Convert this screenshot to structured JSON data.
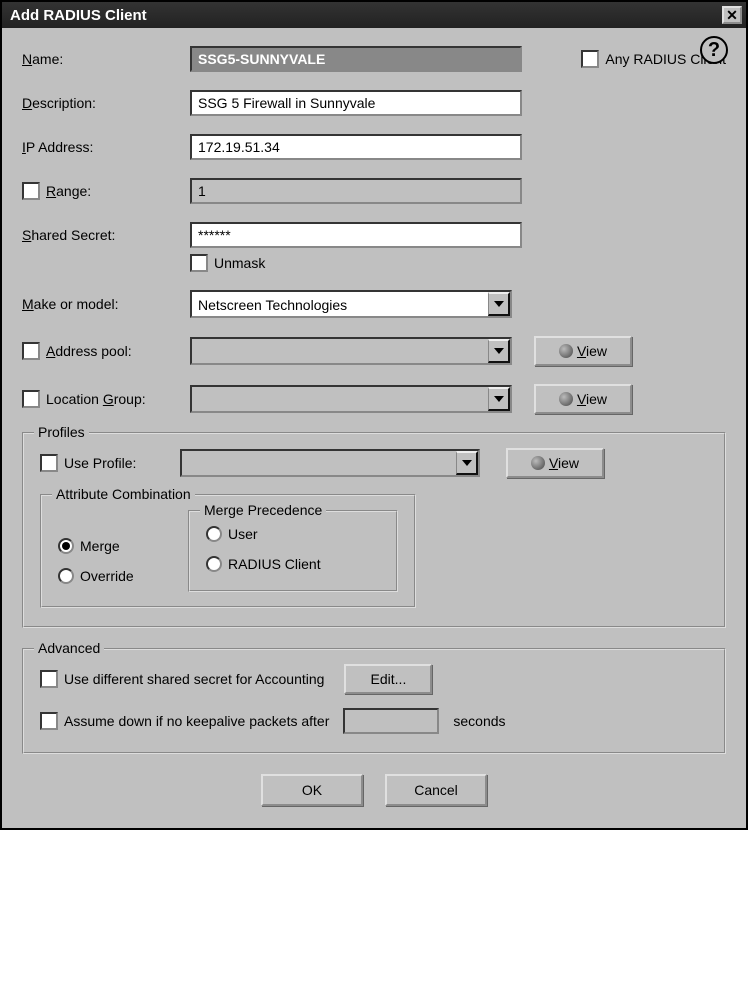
{
  "window": {
    "title": "Add RADIUS Client"
  },
  "labels": {
    "name": "Name:",
    "any_client": "Any RADIUS Client",
    "description": "Description:",
    "ip_address": "IP Address:",
    "range": "Range:",
    "shared_secret": "Shared Secret:",
    "unmask": "Unmask",
    "make_model": "Make or model:",
    "address_pool": "Address pool:",
    "location_group": "Location Group:",
    "profiles_legend": "Profiles",
    "use_profile": "Use Profile:",
    "attr_combo_legend": "Attribute Combination",
    "merge": "Merge",
    "override": "Override",
    "merge_prec_legend": "Merge Precedence",
    "user": "User",
    "radius_client": "RADIUS Client",
    "advanced_legend": "Advanced",
    "diff_secret": "Use different shared secret for Accounting",
    "assume_down_prefix": "Assume down if no keepalive packets after",
    "assume_down_suffix": "seconds"
  },
  "values": {
    "name": "SSG5-SUNNYVALE",
    "description": "SSG 5 Firewall in Sunnyvale",
    "ip_address": "172.19.51.34",
    "range": "1",
    "shared_secret": "******",
    "make_model": "Netscreen Technologies",
    "address_pool": "",
    "location_group": "",
    "use_profile": "",
    "keepalive_seconds": ""
  },
  "buttons": {
    "view": "View",
    "edit": "Edit...",
    "ok": "OK",
    "cancel": "Cancel"
  },
  "state": {
    "any_client": false,
    "range_enabled": false,
    "unmask": false,
    "address_pool_enabled": false,
    "location_group_enabled": false,
    "use_profile_enabled": false,
    "attr_mode": "merge",
    "merge_precedence": "",
    "diff_secret": false,
    "assume_down": false
  }
}
